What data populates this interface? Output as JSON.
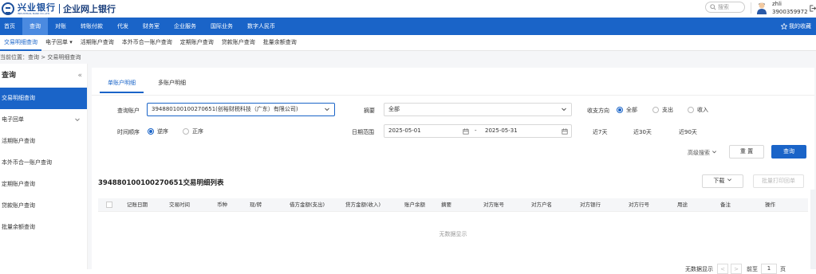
{
  "header": {
    "bank_name": "兴业银行",
    "bank_name_en": "INDUSTRIAL BANK CO.,LTD.",
    "portal_title": "企业网上银行",
    "search_placeholder": "搜索",
    "user_name": "zhli",
    "user_id": "3900359972"
  },
  "nav": {
    "items": [
      "首页",
      "查询",
      "对账",
      "转账付款",
      "代发",
      "财务室",
      "企业服务",
      "国际业务",
      "数字人民币"
    ],
    "active": 1,
    "favorites": "我的收藏"
  },
  "subnav": {
    "items": [
      "交易明细查询",
      "电子回单 ▾",
      "活期账户查询",
      "本外币合一账户查询",
      "定期账户查询",
      "贷款账户查询",
      "批量余额查询"
    ],
    "active": 0
  },
  "breadcrumb": "当前位置：查询 > 交易明细查询",
  "sidebar": {
    "title": "查询",
    "collapse": "«",
    "items": [
      "交易明细查询",
      "电子回单",
      "活期账户查询",
      "本外币合一账户查询",
      "定期账户查询",
      "贷款账户查询",
      "批量余额查询"
    ],
    "active": 0
  },
  "tabs": [
    "单账户明细",
    "多账户明细"
  ],
  "form": {
    "account_label": "查询账户",
    "account_value": "394880100100270651(创裕财税科技（广东）有限公司)",
    "summary_label": "摘要",
    "summary_value": "全部",
    "direction_label": "收支方向",
    "direction_options": [
      "全部",
      "支出",
      "收入"
    ],
    "order_label": "时间顺序",
    "order_options": [
      "逆序",
      "正序"
    ],
    "date_label": "日期范围",
    "date_start": "2025-05-01",
    "date_sep": "-",
    "date_end": "2025-05-31",
    "quick_ranges": [
      "近7天",
      "近30天",
      "近90天"
    ],
    "advanced": "高级搜索",
    "reset": "重 置",
    "search": "查询"
  },
  "list": {
    "title": "394880100100270651交易明细列表",
    "download": "下载",
    "batch_print": "批量打印回单",
    "columns": [
      "记账日期",
      "交易时间",
      "币种",
      "现/转",
      "借方金额(支出)",
      "贷方金额(收入)",
      "账户余额",
      "摘要",
      "对方账号",
      "对方户名",
      "对方银行",
      "对方行号",
      "用途",
      "备注",
      "操作"
    ],
    "empty": "无数据显示"
  },
  "pager": {
    "info": "无数据显示",
    "prev": "<",
    "next": ">",
    "goto": "前至",
    "page": "1",
    "unit": "页"
  }
}
